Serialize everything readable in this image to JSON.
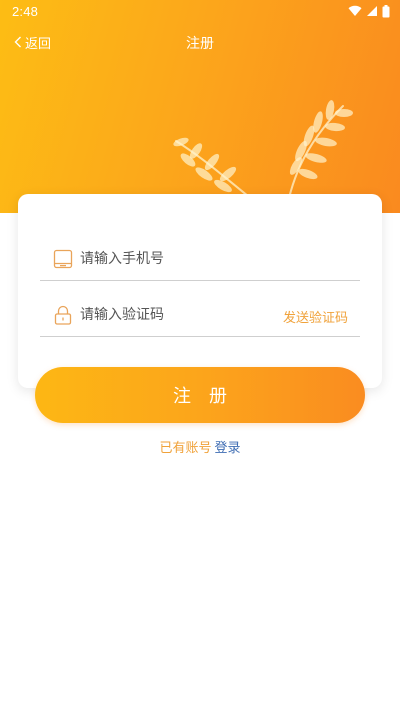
{
  "status_bar": {
    "time": "2:48",
    "icons": [
      "wifi-icon",
      "signal-icon",
      "battery-icon"
    ]
  },
  "nav": {
    "back_label": "返回",
    "title": "注册"
  },
  "form": {
    "phone_placeholder": "请输入手机号",
    "phone_value": "",
    "code_placeholder": "请输入验证码",
    "code_value": "",
    "send_code_label": "发送验证码"
  },
  "register_button": {
    "label": "注册"
  },
  "login_prompt": {
    "text": "已有账号",
    "link": "登录"
  },
  "colors": {
    "header_gradient_start": "#fdbd14",
    "header_gradient_end": "#fa8a1f",
    "accent": "#f0a23a",
    "link": "#3f6db3"
  }
}
